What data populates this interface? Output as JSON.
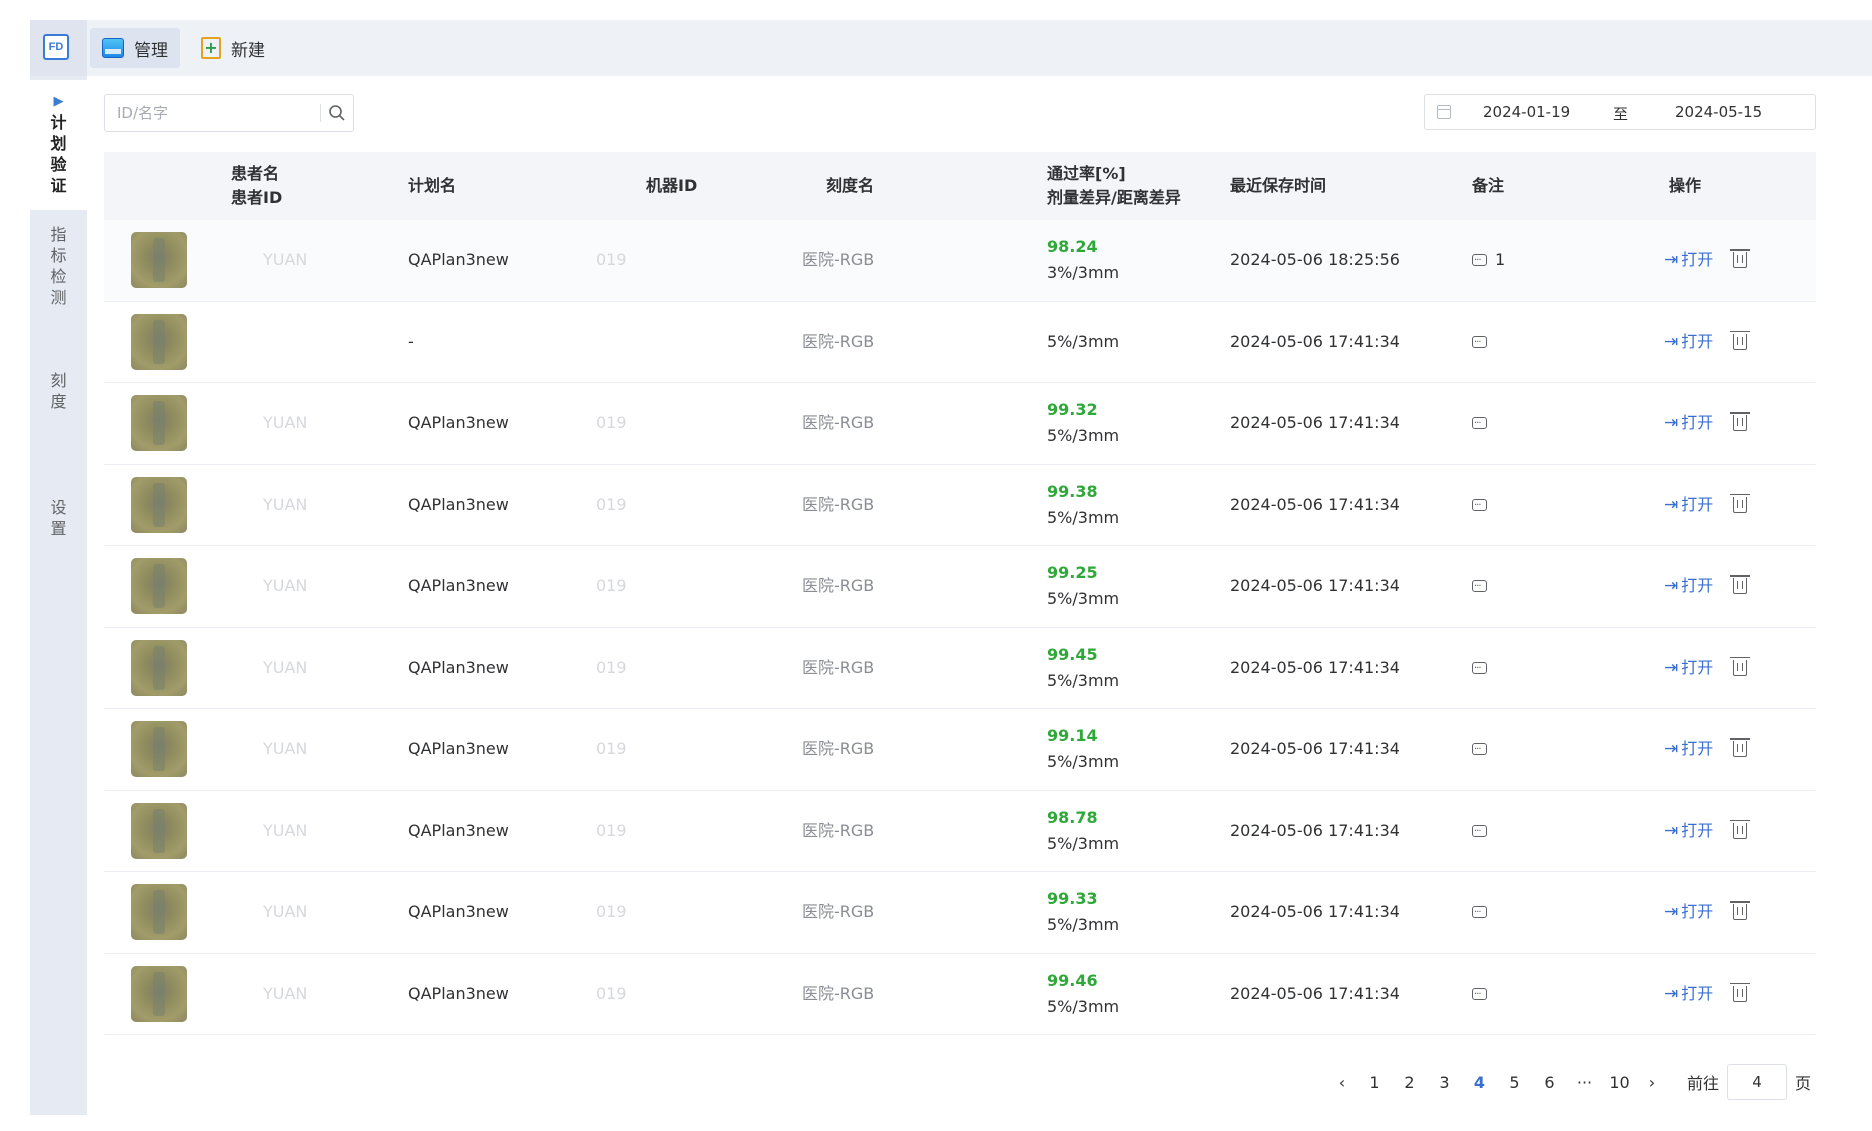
{
  "sidebar": {
    "logo": "FD",
    "items": [
      {
        "label": [
          "计",
          "划",
          "验",
          "证"
        ],
        "active": true
      },
      {
        "label": [
          "指",
          "标",
          "检",
          "测"
        ],
        "active": false
      },
      {
        "label": [
          "刻",
          "度"
        ],
        "active": false
      },
      {
        "label": [
          "设",
          "置"
        ],
        "active": false
      }
    ]
  },
  "toolbar": {
    "manage_label": "管理",
    "new_label": "新建"
  },
  "filters": {
    "search_placeholder": "ID/名字",
    "date_start": "2024-01-19",
    "date_sep": "至",
    "date_end": "2024-05-15"
  },
  "table": {
    "headers": {
      "patient_name": "患者名",
      "patient_id": "患者ID",
      "plan": "计划名",
      "machine": "机器ID",
      "scale": "刻度名",
      "pass_rate": "通过率[%]",
      "criteria": "剂量差异/距离差异",
      "saved": "最近保存时间",
      "note": "备注",
      "ops": "操作"
    },
    "open_label": "打开",
    "rows": [
      {
        "patient": "YUAN",
        "plan": "QAPlan3new",
        "machine": "019",
        "scale": "医院-RGB",
        "pass": "98.24",
        "criteria": "3%/3mm",
        "saved": "2024-05-06 18:25:56",
        "note": "1"
      },
      {
        "patient": "",
        "plan": "-",
        "machine": "",
        "scale": "医院-RGB",
        "pass": "",
        "criteria": "5%/3mm",
        "saved": "2024-05-06 17:41:34",
        "note": ""
      },
      {
        "patient": "YUAN",
        "plan": "QAPlan3new",
        "machine": "019",
        "scale": "医院-RGB",
        "pass": "99.32",
        "criteria": "5%/3mm",
        "saved": "2024-05-06 17:41:34",
        "note": ""
      },
      {
        "patient": "YUAN",
        "plan": "QAPlan3new",
        "machine": "019",
        "scale": "医院-RGB",
        "pass": "99.38",
        "criteria": "5%/3mm",
        "saved": "2024-05-06 17:41:34",
        "note": ""
      },
      {
        "patient": "YUAN",
        "plan": "QAPlan3new",
        "machine": "019",
        "scale": "医院-RGB",
        "pass": "99.25",
        "criteria": "5%/3mm",
        "saved": "2024-05-06 17:41:34",
        "note": ""
      },
      {
        "patient": "YUAN",
        "plan": "QAPlan3new",
        "machine": "019",
        "scale": "医院-RGB",
        "pass": "99.45",
        "criteria": "5%/3mm",
        "saved": "2024-05-06 17:41:34",
        "note": ""
      },
      {
        "patient": "YUAN",
        "plan": "QAPlan3new",
        "machine": "019",
        "scale": "医院-RGB",
        "pass": "99.14",
        "criteria": "5%/3mm",
        "saved": "2024-05-06 17:41:34",
        "note": ""
      },
      {
        "patient": "YUAN",
        "plan": "QAPlan3new",
        "machine": "019",
        "scale": "医院-RGB",
        "pass": "98.78",
        "criteria": "5%/3mm",
        "saved": "2024-05-06 17:41:34",
        "note": ""
      },
      {
        "patient": "YUAN",
        "plan": "QAPlan3new",
        "machine": "019",
        "scale": "医院-RGB",
        "pass": "99.33",
        "criteria": "5%/3mm",
        "saved": "2024-05-06 17:41:34",
        "note": ""
      },
      {
        "patient": "YUAN",
        "plan": "QAPlan3new",
        "machine": "019",
        "scale": "医院-RGB",
        "pass": "99.46",
        "criteria": "5%/3mm",
        "saved": "2024-05-06 17:41:34",
        "note": ""
      }
    ]
  },
  "pagination": {
    "prev": "‹",
    "next": "›",
    "pages": [
      "1",
      "2",
      "3",
      "4",
      "5",
      "6",
      "···",
      "10"
    ],
    "current": "4",
    "goto_prefix": "前往",
    "goto_value": "4",
    "goto_suffix": "页"
  }
}
